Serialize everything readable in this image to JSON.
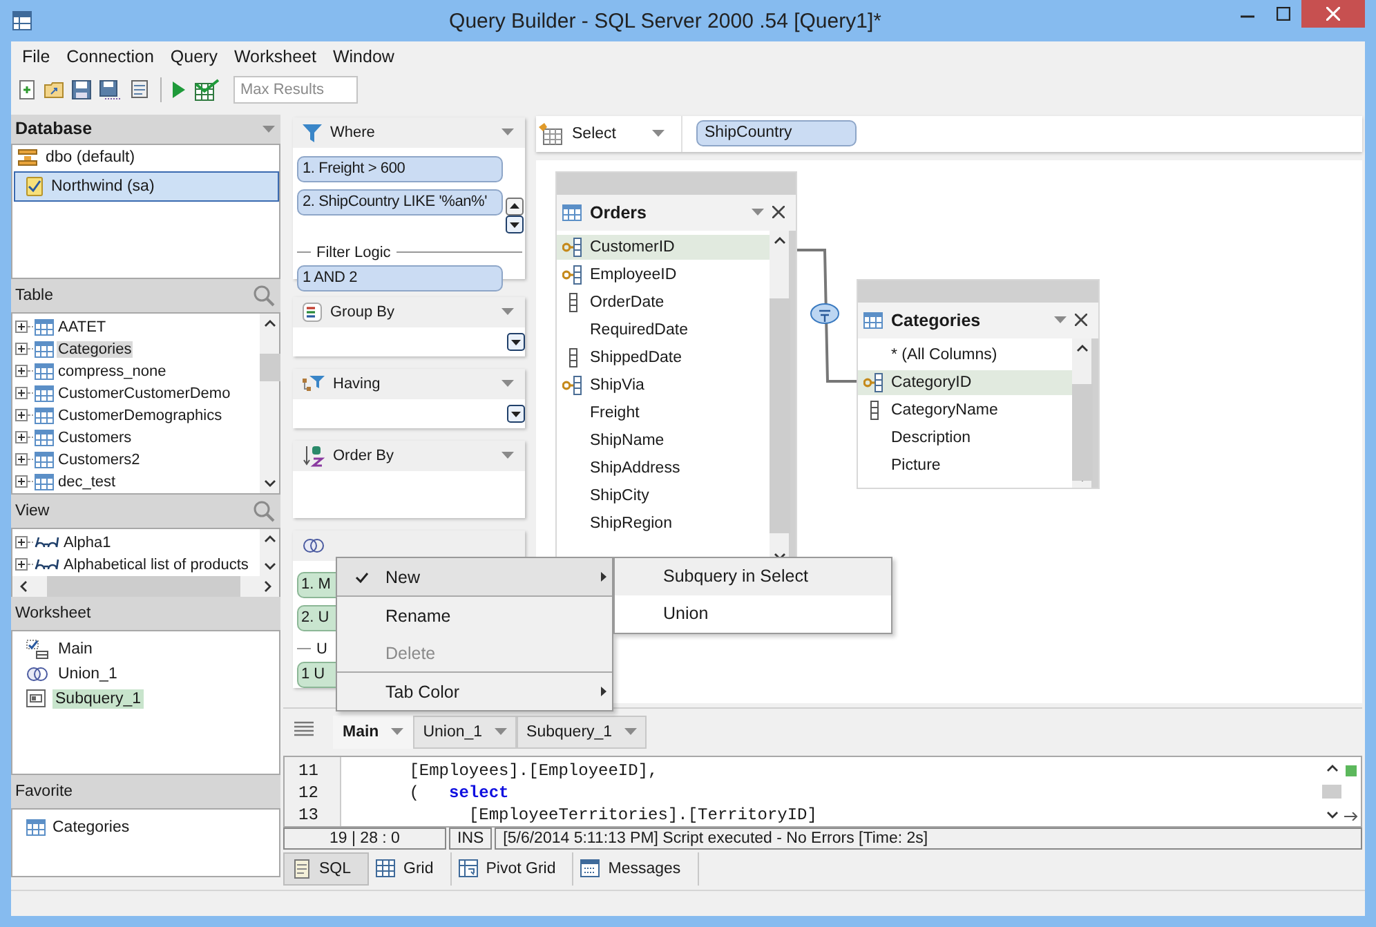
{
  "window": {
    "title": "Query Builder - SQL Server 2000 .54 [Query1]*"
  },
  "menu": [
    "File",
    "Connection",
    "Query",
    "Worksheet",
    "Window"
  ],
  "toolbar": {
    "max_results": {
      "placeholder": "Max Results"
    }
  },
  "database": {
    "title": "Database",
    "schema": "dbo (default)",
    "connections": [
      {
        "label": "Northwind (sa)",
        "selected": true
      }
    ]
  },
  "table_list": {
    "title": "Table",
    "items": [
      {
        "label": "AATET",
        "selected": false
      },
      {
        "label": "Categories",
        "selected": true
      },
      {
        "label": "compress_none",
        "selected": false
      },
      {
        "label": "CustomerCustomerDemo",
        "selected": false
      },
      {
        "label": "CustomerDemographics",
        "selected": false
      },
      {
        "label": "Customers",
        "selected": false
      },
      {
        "label": "Customers2",
        "selected": false
      },
      {
        "label": "dec_test",
        "selected": false
      }
    ]
  },
  "view_list": {
    "title": "View",
    "items": [
      "Alpha1",
      "Alphabetical list of products"
    ]
  },
  "worksheets": {
    "title": "Worksheet",
    "items": [
      {
        "kind": "main",
        "label": "Main",
        "selected": false
      },
      {
        "kind": "union",
        "label": "Union_1",
        "selected": false
      },
      {
        "kind": "subquery",
        "label": "Subquery_1",
        "selected": true
      }
    ]
  },
  "favorites": {
    "title": "Favorite",
    "items": [
      "Categories"
    ]
  },
  "where": {
    "title": "Where",
    "conditions": [
      "1. Freight > 600",
      "2. ShipCountry LIKE '%an%'"
    ],
    "logic_label": "Filter Logic",
    "logic": "1 AND 2"
  },
  "group_by": {
    "title": "Group By"
  },
  "having": {
    "title": "Having"
  },
  "order_by": {
    "title": "Order By"
  },
  "union": {
    "items": [
      "1. M",
      "2. U"
    ],
    "logic_label": "U",
    "logic": "1 U"
  },
  "select": {
    "label": "Select",
    "fields": [
      "ShipCountry"
    ]
  },
  "diagram": {
    "tables": [
      {
        "name": "Orders",
        "columns": [
          {
            "name": "CustomerID",
            "kind": "key",
            "selected": true
          },
          {
            "name": "EmployeeID",
            "kind": "key",
            "selected": false
          },
          {
            "name": "OrderDate",
            "kind": "index",
            "selected": false
          },
          {
            "name": "RequiredDate",
            "kind": "plain",
            "selected": false
          },
          {
            "name": "ShippedDate",
            "kind": "index",
            "selected": false
          },
          {
            "name": "ShipVia",
            "kind": "key",
            "selected": false
          },
          {
            "name": "Freight",
            "kind": "plain",
            "selected": false
          },
          {
            "name": "ShipName",
            "kind": "plain",
            "selected": false
          },
          {
            "name": "ShipAddress",
            "kind": "plain",
            "selected": false
          },
          {
            "name": "ShipCity",
            "kind": "plain",
            "selected": false
          },
          {
            "name": "ShipRegion",
            "kind": "plain",
            "selected": false
          }
        ]
      },
      {
        "name": "Categories",
        "columns": [
          {
            "name": "* (All Columns)",
            "kind": "plain",
            "selected": false
          },
          {
            "name": "CategoryID",
            "kind": "key",
            "selected": true
          },
          {
            "name": "CategoryName",
            "kind": "index",
            "selected": false
          },
          {
            "name": "Description",
            "kind": "plain",
            "selected": false
          },
          {
            "name": "Picture",
            "kind": "plain",
            "selected": false
          }
        ]
      }
    ]
  },
  "context_menu": {
    "items": [
      {
        "label": "New",
        "checked": true,
        "submenu": true,
        "selected": true,
        "disabled": false,
        "separator_before": false
      },
      {
        "label": "Rename",
        "checked": false,
        "submenu": false,
        "selected": false,
        "disabled": false,
        "separator_before": true
      },
      {
        "label": "Delete",
        "checked": false,
        "submenu": false,
        "selected": false,
        "disabled": true,
        "separator_before": false
      },
      {
        "label": "Tab Color",
        "checked": false,
        "submenu": true,
        "selected": false,
        "disabled": false,
        "separator_before": true
      }
    ]
  },
  "submenu": {
    "items": [
      {
        "label": "Subquery in Select",
        "selected": true
      },
      {
        "label": "Union",
        "selected": false
      }
    ]
  },
  "worksheet_tabs": [
    {
      "label": "Main",
      "selected": true
    },
    {
      "label": "Union_1",
      "selected": false
    },
    {
      "label": "Subquery_1",
      "selected": false
    }
  ],
  "sql": {
    "lines": [
      {
        "number": "11",
        "text": "      [Employees].[EmployeeID],"
      },
      {
        "number": "12",
        "text": "      (   **select**"
      },
      {
        "number": "13",
        "text": "            [EmployeeTerritories].[TerritoryID]"
      }
    ]
  },
  "status": {
    "position": "19 | 28 : 0",
    "mode": "INS",
    "message": "[5/6/2014 5:11:13 PM] Script executed - No Errors [Time: 2s]"
  },
  "result_tabs": [
    {
      "kind": "sql",
      "label": "SQL",
      "selected": true
    },
    {
      "kind": "grid",
      "label": "Grid",
      "selected": false
    },
    {
      "kind": "pivot",
      "label": "Pivot Grid",
      "selected": false
    },
    {
      "kind": "messages",
      "label": "Messages",
      "selected": false
    }
  ]
}
